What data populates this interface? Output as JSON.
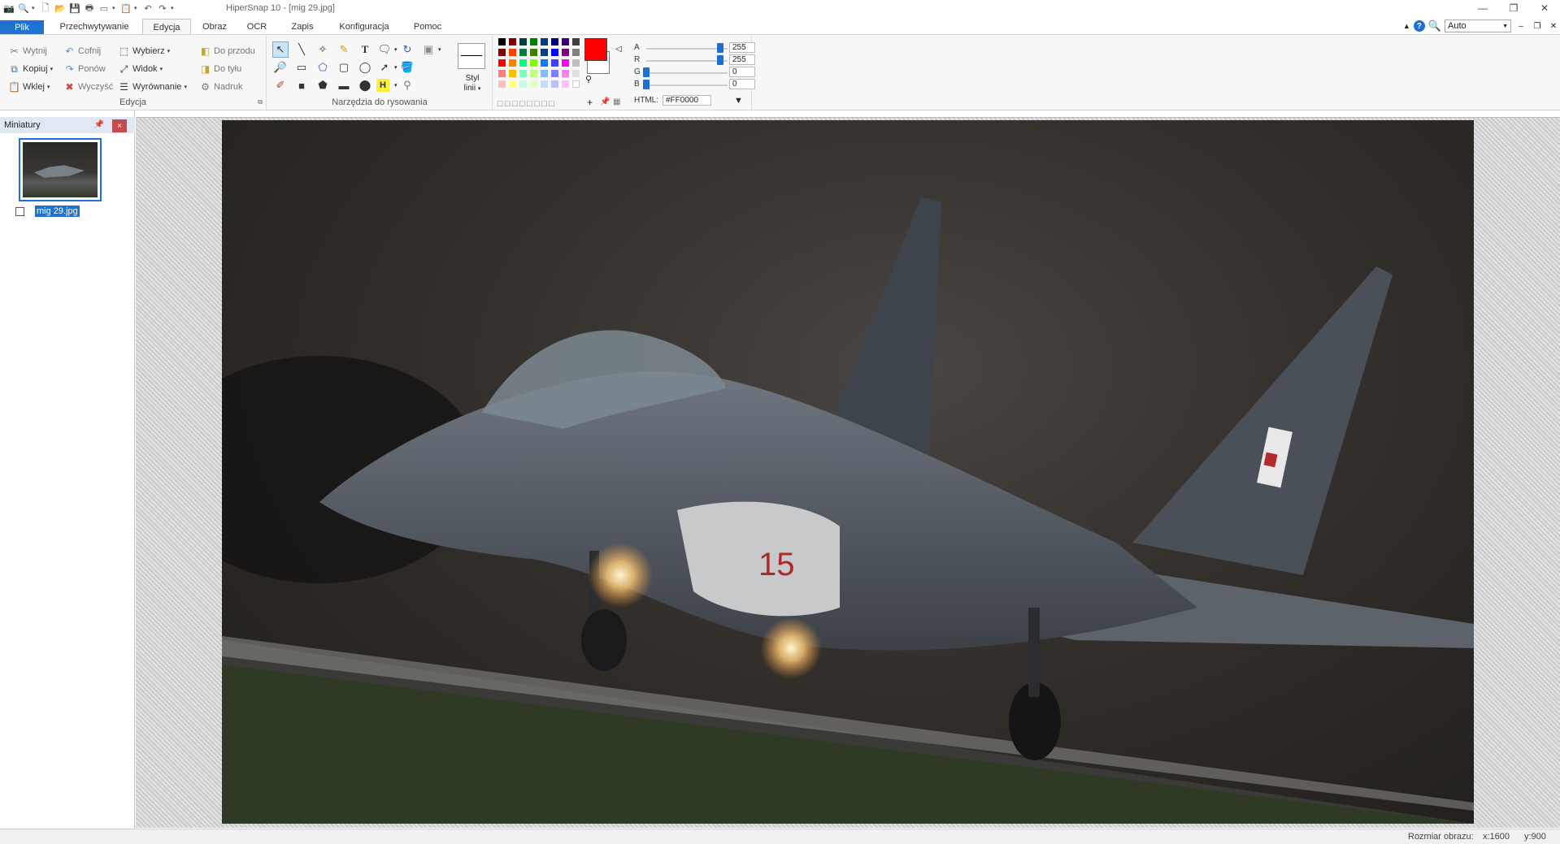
{
  "window": {
    "title": "HiperSnap 10 - [mig 29.jpg]",
    "controls": {
      "minimize": "—",
      "restore": "❐",
      "close": "✕"
    }
  },
  "tabs": [
    {
      "label": "Plik"
    },
    {
      "label": "Przechwytywanie"
    },
    {
      "label": "Edycja"
    },
    {
      "label": "Obraz"
    },
    {
      "label": "OCR"
    },
    {
      "label": "Zapis"
    },
    {
      "label": "Konfiguracja"
    },
    {
      "label": "Pomoc"
    }
  ],
  "tabbar_right": {
    "help": "?",
    "zoom_value": "Auto"
  },
  "ribbon": {
    "edit_group": {
      "label": "Edycja",
      "cut": "Wytnij",
      "copy": "Kopiuj",
      "paste": "Wklej",
      "undo": "Cofnij",
      "redo": "Ponów",
      "clear": "Wyczyść",
      "select": "Wybierz",
      "view": "Widok",
      "align": "Wyrównanie",
      "front": "Do przodu",
      "back": "Do tyłu",
      "stamp": "Nadruk"
    },
    "draw_group": {
      "label": "Narzędzia do rysowania",
      "line_style_line1": "Styl",
      "line_style_line2": "linii"
    },
    "colors": {
      "current": "#FF0000",
      "sliders": {
        "a_label": "A",
        "a_value": "255",
        "r_label": "R",
        "r_value": "255",
        "g_label": "G",
        "g_value": "0",
        "b_label": "B",
        "b_value": "0"
      },
      "html_label": "HTML:",
      "html_value": "#FF0000",
      "palette": [
        "#000000",
        "#7f0000",
        "#004040",
        "#007f00",
        "#003f7f",
        "#00007f",
        "#3f007f",
        "#404040",
        "#7f0000",
        "#ff3f00",
        "#007f3f",
        "#3f7f00",
        "#00407f",
        "#0000ff",
        "#7f007f",
        "#7f7f7f",
        "#ff0000",
        "#ff7f00",
        "#00ff7f",
        "#7fff00",
        "#007fff",
        "#3f3fff",
        "#ff00ff",
        "#bfbfbf",
        "#ff7f7f",
        "#ffbf00",
        "#7fffbf",
        "#bfff7f",
        "#7fbfff",
        "#7f7fff",
        "#ff7fff",
        "#dfdfdf",
        "#ffbfbf",
        "#ffff7f",
        "#bfffdf",
        "#dfffbf",
        "#bfdfff",
        "#bfbfff",
        "#ffbfff",
        "#ffffff"
      ]
    }
  },
  "thumbnails_panel": {
    "title": "Miniatury",
    "pin": "📌",
    "close": "×",
    "items": [
      {
        "label": "mig 29.jpg"
      }
    ]
  },
  "status": {
    "size_label": "Rozmiar obrazu:",
    "x": "x:1600",
    "y": "y:900"
  }
}
